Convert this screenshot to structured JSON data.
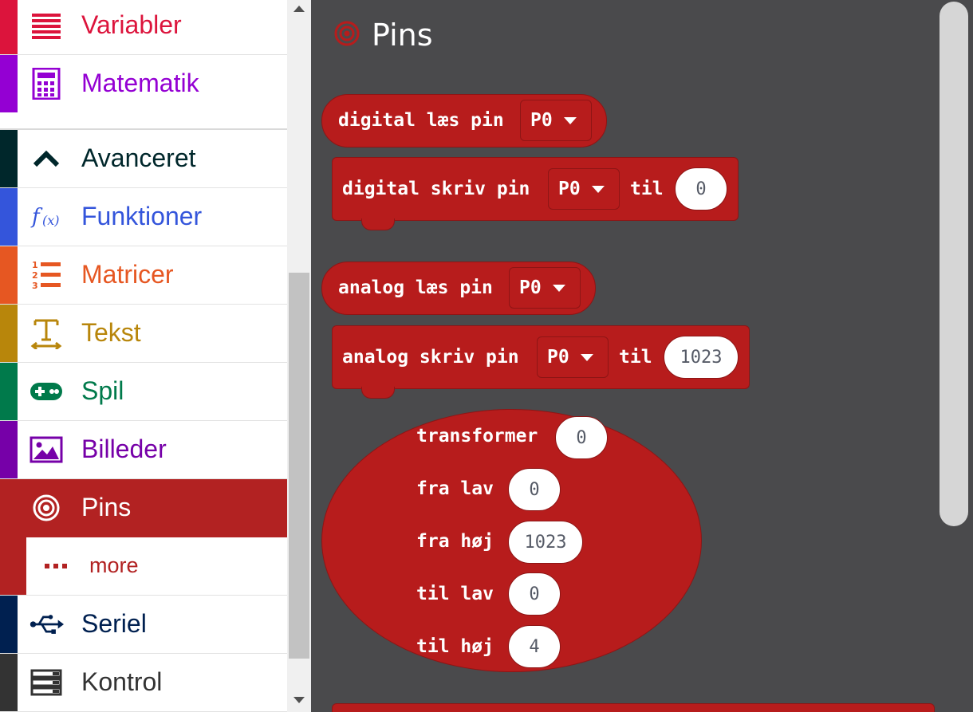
{
  "sidebar": {
    "categories": [
      {
        "label": "Variabler",
        "color": "#dc143c",
        "icon": "variables-icon"
      },
      {
        "label": "Matematik",
        "color": "#9400d3",
        "icon": "calculator-icon"
      },
      {
        "label": "Avanceret",
        "color": "#00272b",
        "icon": "chevron-up-icon"
      },
      {
        "label": "Funktioner",
        "color": "#3455db",
        "icon": "function-icon"
      },
      {
        "label": "Matricer",
        "color": "#e65722",
        "icon": "numbered-list-icon"
      },
      {
        "label": "Tekst",
        "color": "#b8860b",
        "icon": "text-icon"
      },
      {
        "label": "Spil",
        "color": "#007a4b",
        "icon": "gamepad-icon"
      },
      {
        "label": "Billeder",
        "color": "#7600a8",
        "icon": "image-icon"
      },
      {
        "label": "Pins",
        "color": "#b22222",
        "icon": "pins-target-icon",
        "selected": true
      },
      {
        "label": "more",
        "color": "#b22222",
        "icon": "dots-icon"
      },
      {
        "label": "Seriel",
        "color": "#002050",
        "icon": "usb-icon"
      },
      {
        "label": "Kontrol",
        "color": "#333333",
        "icon": "control-icon"
      }
    ]
  },
  "flyout": {
    "title": "Pins",
    "blocks": {
      "digital_read": {
        "text": "digital læs pin",
        "pin": "P0"
      },
      "digital_write": {
        "text": "digital skriv pin",
        "pin": "P0",
        "to": "til",
        "value": "0"
      },
      "analog_read": {
        "text": "analog læs pin",
        "pin": "P0"
      },
      "analog_write": {
        "text": "analog skriv pin",
        "pin": "P0",
        "to": "til",
        "value": "1023"
      },
      "map": {
        "rows": [
          {
            "label": "transformer",
            "value": "0"
          },
          {
            "label": "fra lav",
            "value": "0"
          },
          {
            "label": "fra høj",
            "value": "1023"
          },
          {
            "label": "til lav",
            "value": "0"
          },
          {
            "label": "til høj",
            "value": "4"
          }
        ]
      }
    }
  }
}
